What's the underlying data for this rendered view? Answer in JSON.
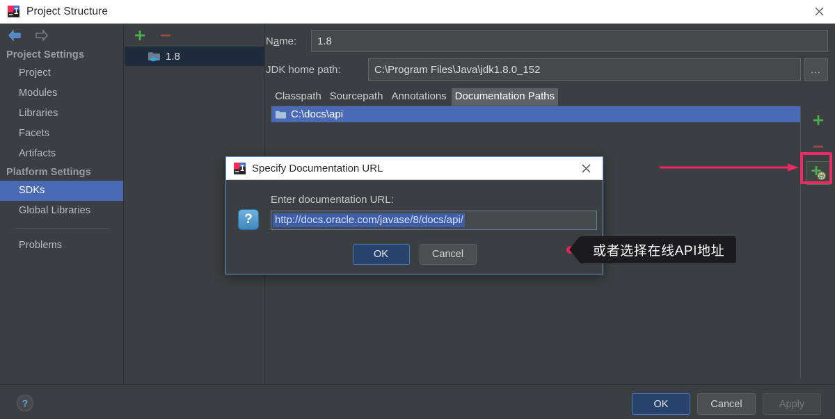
{
  "window": {
    "title": "Project Structure",
    "icon": "intellij-idea-logo",
    "close_label": "✕"
  },
  "nav": {
    "back_icon": "arrow-left-icon",
    "forward_icon": "arrow-right-icon"
  },
  "sidebar": {
    "sections": [
      {
        "heading": "Project Settings",
        "items": [
          {
            "label": "Project",
            "selected": false
          },
          {
            "label": "Modules",
            "selected": false
          },
          {
            "label": "Libraries",
            "selected": false
          },
          {
            "label": "Facets",
            "selected": false
          },
          {
            "label": "Artifacts",
            "selected": false
          }
        ]
      },
      {
        "heading": "Platform Settings",
        "items": [
          {
            "label": "SDKs",
            "selected": true
          },
          {
            "label": "Global Libraries",
            "selected": false
          }
        ]
      }
    ],
    "footer_items": [
      {
        "label": "Problems",
        "selected": false
      }
    ]
  },
  "sdk_list": {
    "add_icon": "plus-icon",
    "remove_icon": "minus-icon",
    "items": [
      {
        "label": "1.8",
        "icon": "java-sdk-folder-icon",
        "selected": true
      }
    ]
  },
  "detail": {
    "name_label": "Name:",
    "name_label_prefix": "N",
    "name_label_mnemonic": "a",
    "name_label_suffix": "me:",
    "name_value": "1.8",
    "jdk_label": "JDK home path:",
    "jdk_value": "C:\\Program Files\\Java\\jdk1.8.0_152",
    "browse_label": "...",
    "tabs": [
      {
        "label": "Classpath",
        "active": false
      },
      {
        "label": "Sourcepath",
        "active": false
      },
      {
        "label": "Annotations",
        "active": false
      },
      {
        "label": "Documentation Paths",
        "active": true
      }
    ],
    "paths": [
      {
        "label": "C:\\docs\\api",
        "icon": "folder-icon",
        "selected": true
      }
    ],
    "toolbar": [
      {
        "name": "add-path-button",
        "icon": "plus-icon"
      },
      {
        "name": "remove-path-button",
        "icon": "minus-icon"
      },
      {
        "name": "add-url-button",
        "icon": "plus-globe-icon",
        "highlighted": true
      }
    ]
  },
  "modal": {
    "title": "Specify Documentation URL",
    "icon": "intellij-idea-logo",
    "close_label": "✕",
    "question_icon": "question-icon",
    "question_glyph": "?",
    "label": "Enter documentation URL:",
    "url_value": "http://docs.oracle.com/javase/8/docs/api/",
    "ok_label": "OK",
    "cancel_label": "Cancel"
  },
  "bottom": {
    "help_label": "?",
    "ok_label": "OK",
    "cancel_label": "Cancel",
    "apply_label": "Apply"
  },
  "annotations": {
    "callout_text": "或者选择在线API地址",
    "arrow_color": "#ec2a66",
    "box_color": "#ec2a66",
    "dot_color": "#e8205a"
  }
}
